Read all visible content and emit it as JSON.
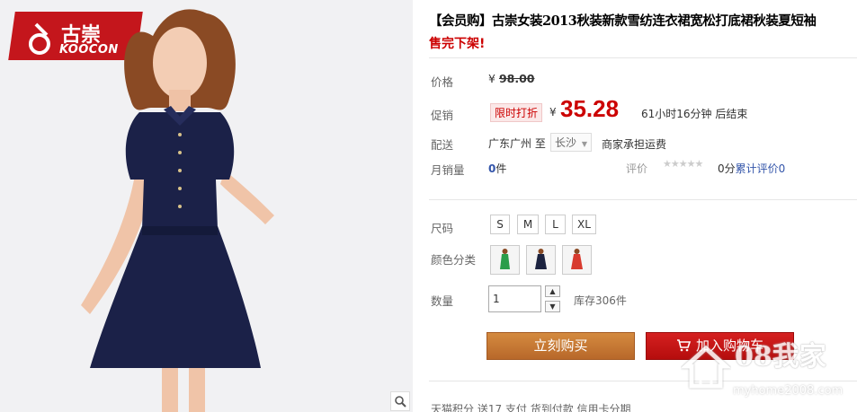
{
  "brand": {
    "name_cn": "古崇",
    "name_en": "KOOCON",
    "color": "#c4161c"
  },
  "product": {
    "title": "【会员购】古崇女装2013秋装新款雪纺连衣裙宽松打底裙秋装夏短袖",
    "status": "售完下架!"
  },
  "price": {
    "label": "价格",
    "original": "98.00",
    "currency": "¥"
  },
  "promo": {
    "label": "促销",
    "badge": "限时打折",
    "currency": "¥",
    "price": "35.28",
    "countdown": "61小时16分钟 后结束",
    "color": "#cc0000"
  },
  "shipping": {
    "label": "配送",
    "from": "广东广州 至",
    "to": "长沙",
    "note": "商家承担运费"
  },
  "sales": {
    "label": "月销量",
    "count": "0",
    "unit": "件",
    "review_label": "评价",
    "stars": "★★★★★",
    "score": "0分",
    "review_link": "累计评价0"
  },
  "size": {
    "label": "尺码",
    "options": [
      "S",
      "M",
      "L",
      "XL"
    ]
  },
  "color": {
    "label": "颜色分类",
    "options": [
      {
        "icon": "green-dress-swatch",
        "hex": "#2a9d4a"
      },
      {
        "icon": "navy-dress-swatch",
        "hex": "#1c2340"
      },
      {
        "icon": "red-dress-swatch",
        "hex": "#d83a2e"
      }
    ]
  },
  "quantity": {
    "label": "数量",
    "value": "1",
    "stock": "库存306件"
  },
  "actions": {
    "buy": "立刻购买",
    "cart": "加入购物车"
  },
  "bottom_row": "天猫积分    送17                                   支付    货到付款    信用卡分期",
  "watermark": {
    "text": "08我家",
    "url": "myhome2008.com"
  }
}
